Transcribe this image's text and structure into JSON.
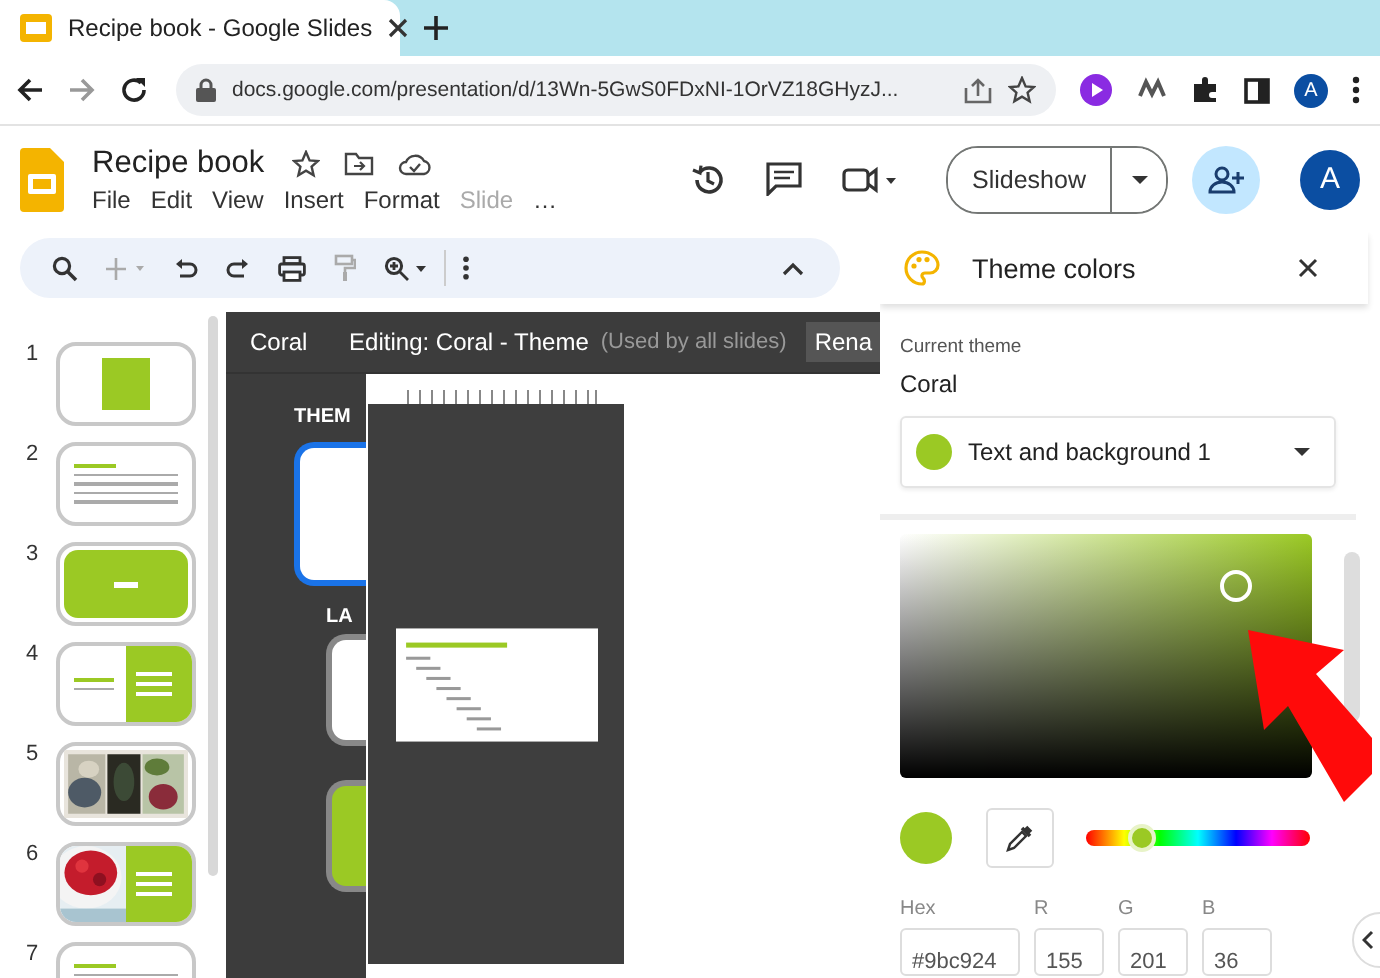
{
  "browser": {
    "tab_title": "Recipe book - Google Slides",
    "url": "docs.google.com/presentation/d/13Wn-5GwS0FDxNI-1OrVZ18GHyzJ...",
    "profile": "A"
  },
  "app": {
    "title": "Recipe book",
    "menus": [
      {
        "label": "File",
        "disabled": false
      },
      {
        "label": "Edit",
        "disabled": false
      },
      {
        "label": "View",
        "disabled": false
      },
      {
        "label": "Insert",
        "disabled": false
      },
      {
        "label": "Format",
        "disabled": false
      },
      {
        "label": "Slide",
        "disabled": true
      }
    ],
    "more": "…",
    "slideshow": "Slideshow",
    "avatar": "A"
  },
  "filmstrip": [
    {
      "number": "1",
      "kind": "title"
    },
    {
      "number": "2",
      "kind": "text"
    },
    {
      "number": "3",
      "kind": "section"
    },
    {
      "number": "4",
      "kind": "split"
    },
    {
      "number": "5",
      "kind": "photos"
    },
    {
      "number": "6",
      "kind": "photo-split"
    },
    {
      "number": "7",
      "kind": "text"
    }
  ],
  "editor": {
    "theme": "Coral",
    "title": "Editing: Coral - Theme",
    "note": "(Used by all slides)",
    "rename": "Rena",
    "theme_label": "THEM",
    "layouts_label": "LA"
  },
  "panel": {
    "title": "Theme colors",
    "current_label": "Current theme",
    "current": "Coral",
    "color_slot": "Text and background 1",
    "hue": {
      "level": 0.25
    },
    "fields": [
      {
        "label": "Hex",
        "value": "#9bc924"
      },
      {
        "label": "R",
        "value": "155"
      },
      {
        "label": "G",
        "value": "201"
      },
      {
        "label": "B",
        "value": "36"
      }
    ]
  }
}
